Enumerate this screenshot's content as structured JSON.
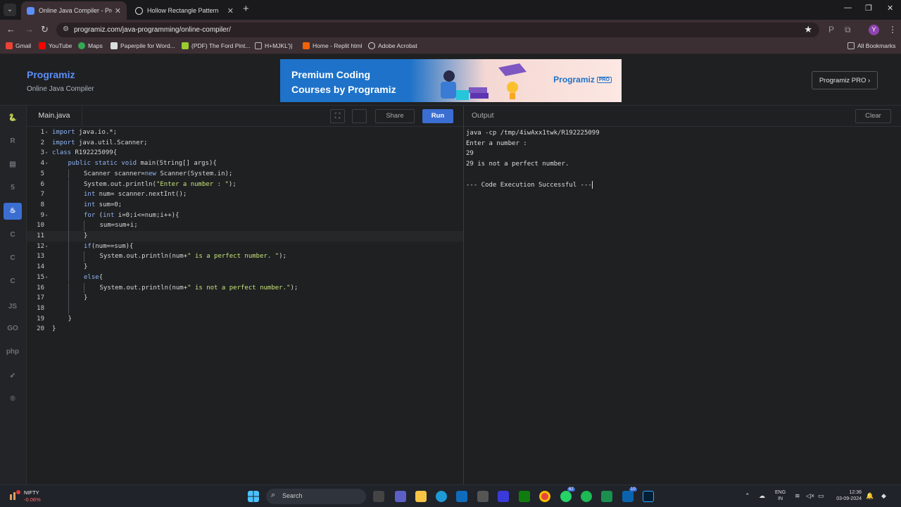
{
  "browser": {
    "tabs": [
      {
        "title": "Online Java Compiler - Program",
        "active": true,
        "favicon_color": "#5b8ff9"
      },
      {
        "title": "Hollow Rectangle Pattern",
        "active": false,
        "favicon_color": "#dddddd"
      }
    ],
    "url": "programiz.com/java-programming/online-compiler/",
    "bookmarks": [
      {
        "label": "Gmail",
        "icon_color": "#ea4335"
      },
      {
        "label": "YouTube",
        "icon_color": "#ff0000"
      },
      {
        "label": "Maps",
        "icon_color": "#34a853"
      },
      {
        "label": "Paperpile for Word...",
        "icon_color": "#dddddd"
      },
      {
        "label": "(PDF) The Ford Pint...",
        "icon_color": "#9acd32"
      },
      {
        "label": "H+MJKL'}|",
        "icon_color": "#888888"
      },
      {
        "label": "Home - Replit html",
        "icon_color": "#f26207"
      },
      {
        "label": "Adobe Acrobat",
        "icon_color": "#dddddd"
      }
    ],
    "all_bookmarks": "All Bookmarks",
    "profile_initial": "Y"
  },
  "site": {
    "logo": "Programiz",
    "subtitle": "Online Java Compiler",
    "banner_text": "Premium Coding\nCourses by Programiz",
    "banner_logo": "Programiz",
    "banner_badge": "PRO",
    "pro_button": "Programiz PRO ›"
  },
  "sidebar": {
    "languages": [
      {
        "name": "python-icon",
        "glyph": "🐍",
        "active": false
      },
      {
        "name": "r-icon",
        "glyph": "R",
        "active": false
      },
      {
        "name": "sql-icon",
        "glyph": "▤",
        "active": false
      },
      {
        "name": "html-icon",
        "glyph": "5",
        "active": false
      },
      {
        "name": "java-icon",
        "glyph": "♨",
        "active": true
      },
      {
        "name": "c-icon",
        "glyph": "C",
        "active": false
      },
      {
        "name": "cpp-icon",
        "glyph": "C",
        "active": false
      },
      {
        "name": "csharp-icon",
        "glyph": "C",
        "active": false
      },
      {
        "name": "js-icon",
        "glyph": "JS",
        "active": false
      },
      {
        "name": "go-icon",
        "glyph": "GO",
        "active": false
      },
      {
        "name": "php-icon",
        "glyph": "php",
        "active": false
      },
      {
        "name": "swift-icon",
        "glyph": "➶",
        "active": false
      },
      {
        "name": "rust-icon",
        "glyph": "®",
        "active": false
      }
    ]
  },
  "editor": {
    "file_tab": "Main.java",
    "share_label": "Share",
    "run_label": "Run",
    "highlighted_line": 11,
    "lines": [
      {
        "n": "1",
        "fold": true,
        "indent": 0,
        "text": "import java.io.*;"
      },
      {
        "n": "2",
        "fold": false,
        "indent": 0,
        "text": "import java.util.Scanner;"
      },
      {
        "n": "3",
        "fold": true,
        "indent": 0,
        "text": "class R192225099{"
      },
      {
        "n": "4",
        "fold": true,
        "indent": 1,
        "text": "public static void main(String[] args){"
      },
      {
        "n": "5",
        "fold": false,
        "indent": 2,
        "text": "Scanner scanner=new Scanner(System.in);"
      },
      {
        "n": "6",
        "fold": false,
        "indent": 2,
        "text": "System.out.println(\"Enter a number : \");"
      },
      {
        "n": "7",
        "fold": false,
        "indent": 2,
        "text": "int num= scanner.nextInt();"
      },
      {
        "n": "8",
        "fold": false,
        "indent": 2,
        "text": "int sum=0;"
      },
      {
        "n": "9",
        "fold": true,
        "indent": 2,
        "text": "for (int i=0;i<=num;i++){"
      },
      {
        "n": "10",
        "fold": false,
        "indent": 3,
        "text": "sum=sum+i;"
      },
      {
        "n": "11",
        "fold": false,
        "indent": 2,
        "text": "}"
      },
      {
        "n": "12",
        "fold": true,
        "indent": 2,
        "text": "if(num==sum){"
      },
      {
        "n": "13",
        "fold": false,
        "indent": 3,
        "text": "System.out.println(num+\" is a perfect number. \");"
      },
      {
        "n": "14",
        "fold": false,
        "indent": 2,
        "text": "}"
      },
      {
        "n": "15",
        "fold": true,
        "indent": 2,
        "text": "else{"
      },
      {
        "n": "16",
        "fold": false,
        "indent": 3,
        "text": "System.out.println(num+\" is not a perfect number.\");"
      },
      {
        "n": "17",
        "fold": false,
        "indent": 2,
        "text": "}"
      },
      {
        "n": "18",
        "fold": false,
        "indent": 2,
        "text": ""
      },
      {
        "n": "19",
        "fold": false,
        "indent": 1,
        "text": "}"
      },
      {
        "n": "20",
        "fold": false,
        "indent": 0,
        "text": "}"
      }
    ]
  },
  "output": {
    "title": "Output",
    "clear_label": "Clear",
    "lines": [
      "java -cp /tmp/4iwAxx1twk/R192225099",
      "Enter a number :",
      "29",
      "29 is not a perfect number.",
      "",
      "--- Code Execution Successful ---"
    ]
  },
  "taskbar": {
    "stock_name": "NIFTY",
    "stock_change": "-0.06%",
    "search_placeholder": "Search",
    "language": "ENG",
    "region": "IN",
    "time": "12:36",
    "date": "03-09-2024",
    "badges": {
      "whatsapp": "62",
      "outlook": "10"
    }
  },
  "colors": {
    "accent": "#3b6ed1",
    "keyword": "#8fb4f5",
    "string": "#c5e478",
    "background": "#1f2022"
  }
}
